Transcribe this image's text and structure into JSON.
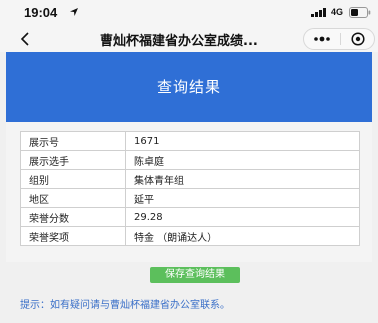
{
  "status_bar": {
    "time": "19:04",
    "network": "4G",
    "location_icon": "location-arrow-icon",
    "signal_icon": "signal-bars-icon",
    "battery_icon": "battery-icon"
  },
  "nav": {
    "back_icon": "chevron-left-icon",
    "title": "曹灿杯福建省办公室成绩...",
    "more_icon": "more-dots-icon",
    "close_icon": "target-close-icon"
  },
  "header": {
    "title": "查询结果",
    "color": "#2f6fd6"
  },
  "result_rows": [
    {
      "label": "展示号",
      "value": "1671"
    },
    {
      "label": "展示选手",
      "value": "陈卓庭"
    },
    {
      "label": "组别",
      "value": "集体青年组"
    },
    {
      "label": "地区",
      "value": "延平"
    },
    {
      "label": "荣誉分数",
      "value": "29.28"
    },
    {
      "label": "荣誉奖项",
      "value": "特金 （朗诵达人）"
    }
  ],
  "actions": {
    "save_label": "保存查询结果",
    "save_color": "#5cbf5c"
  },
  "tip": "提示：如有疑问请与曹灿杯福建省办公室联系。"
}
